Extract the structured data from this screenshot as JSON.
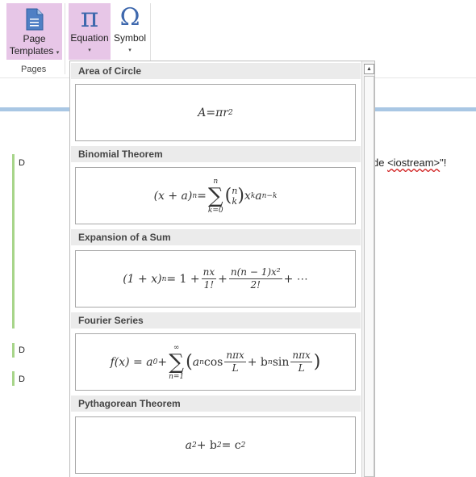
{
  "ribbon": {
    "page_templates_label_line1": "Page",
    "page_templates_label_line2": "Templates",
    "page_templates_arrow": "▾",
    "equation_label": "Equation",
    "equation_arrow": "▾",
    "symbol_label": "Symbol",
    "symbol_arrow": "▾",
    "group_pages": "Pages",
    "equation_glyph": "π",
    "symbol_glyph": "Ω"
  },
  "page": {
    "para1_text": "D",
    "para2_text": "D",
    "para3_text": "D",
    "note_prefix": "de ",
    "note_underlined": "<iostream>",
    "note_suffix": "\"!"
  },
  "gallery": {
    "items": [
      {
        "title": "Area of Circle"
      },
      {
        "title": "Binomial Theorem"
      },
      {
        "title": "Expansion of a Sum"
      },
      {
        "title": "Fourier Series"
      },
      {
        "title": "Pythagorean Theorem"
      }
    ],
    "scroll_up_glyph": "▲"
  },
  "equations": {
    "area": {
      "lhs": "A",
      "eq": " = ",
      "rhs": "πr",
      "exp": "2"
    },
    "binom": {
      "lhs": "(x + a)",
      "lhs_exp": "n",
      "eq": " = ",
      "sum_top": "n",
      "sum_bottom": "k=0",
      "sigma": "∑",
      "paren_open": "(",
      "paren_close": ")",
      "binom_top": "n",
      "binom_bot": "k",
      "x": "x",
      "x_exp": "k",
      "a": "a",
      "a_exp": "n−k"
    },
    "expansion": {
      "lhs": "(1 + x)",
      "lhs_exp": "n",
      "eq": " = 1 + ",
      "f1_num": "nx",
      "f1_den": "1!",
      "plus": " + ",
      "f2_num": "n(n − 1)x²",
      "f2_den": "2!",
      "tail": " + ⋯"
    },
    "fourier": {
      "lhs": "f(x) = a",
      "a0_sub": "0",
      "plus": " + ",
      "sum_top": "∞",
      "sum_bottom": "n=1",
      "sigma": "∑",
      "open": "(",
      "an": "a",
      "an_sub": "n",
      "cos": " cos",
      "f1_num": "nπx",
      "f1_den": "L",
      "mid": " + b",
      "bn_sub": "n",
      "sin": " sin",
      "f2_num": "nπx",
      "f2_den": "L",
      "close": ")"
    },
    "pythag": {
      "a": "a",
      "a_exp": "2",
      "plus": " + b",
      "b_exp": "2",
      "eq": " = c",
      "c_exp": "2"
    }
  }
}
